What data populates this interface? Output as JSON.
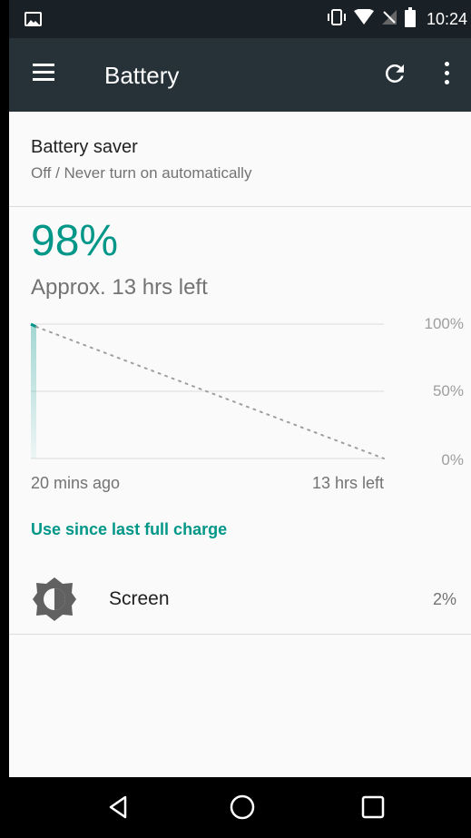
{
  "status_bar": {
    "time": "10:24",
    "left_icon": "image-notification-icon",
    "right_icons": [
      "vibrate-icon",
      "wifi-icon",
      "no-sim-icon",
      "battery-icon"
    ]
  },
  "toolbar": {
    "title": "Battery",
    "menu_icon": "menu-icon",
    "refresh_icon": "refresh-icon",
    "more_icon": "more-vert-icon"
  },
  "battery_saver": {
    "title": "Battery saver",
    "subtitle": "Off / Never turn on automatically"
  },
  "battery": {
    "percent": "98%",
    "estimate": "Approx. 13 hrs left"
  },
  "chart_data": {
    "type": "line",
    "x_labels": [
      "20 mins ago",
      "13 hrs left"
    ],
    "y_ticks": [
      "100%",
      "50%",
      "0%"
    ],
    "ylim": [
      0,
      100
    ],
    "series": [
      {
        "values": [
          100,
          98
        ]
      },
      {
        "values": [
          98,
          0
        ],
        "style": "dotted"
      }
    ],
    "grid": true,
    "accent": "#009688"
  },
  "usage_header": "Use since last full charge",
  "usage_items": [
    {
      "label": "Screen",
      "value": "2%",
      "icon": "brightness-icon"
    }
  ],
  "nav_bar": {
    "buttons": [
      "back-icon",
      "home-icon",
      "recents-icon"
    ]
  },
  "colors": {
    "accent": "#009688",
    "toolbar": "#263238",
    "status_bar": "#1a2126"
  }
}
